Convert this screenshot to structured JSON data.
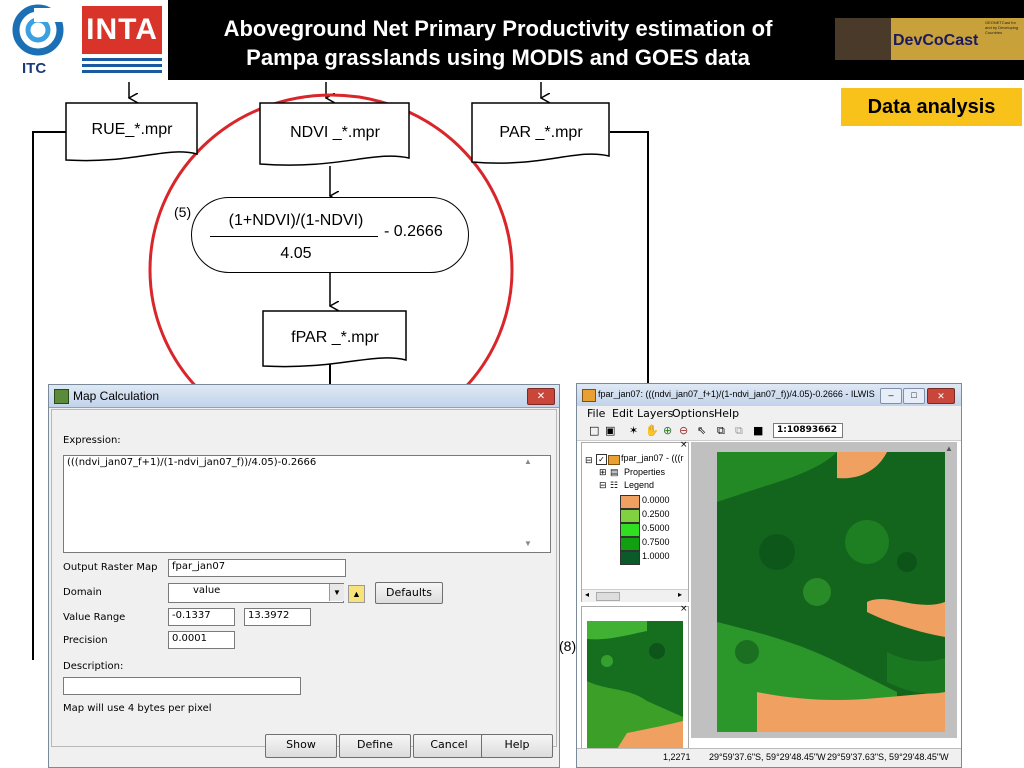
{
  "header": {
    "title": "Aboveground Net Primary Productivity estimation of\nPampa grasslands using MODIS and GOES data",
    "itc_text": "ITC",
    "inta_text": "INTA",
    "devcocast_text": "DevCoCast",
    "devcocast_small": "GEONETCast for and by Developing Countries"
  },
  "section_label": "Data analysis",
  "flowchart": {
    "rue_label": "RUE_*.mpr",
    "ndvi_label": "NDVI _*.mpr",
    "par_label": "PAR _*.mpr",
    "formula_num": "(1+NDVI)/(1-NDVI)",
    "formula_den": "4.05",
    "formula_tail": "- 0.2666",
    "step_number": "(5)",
    "fpar_label": "fPAR _*.mpr",
    "step_number_8": "(8)"
  },
  "map_calc": {
    "title": "Map Calculation",
    "expression_label": "Expression:",
    "expression": "(((ndvi_jan07_f+1)/(1-ndvi_jan07_f))/4.05)-0.2666",
    "output_label": "Output Raster Map",
    "output_value": "fpar_jan07",
    "domain_label": "Domain",
    "domain_value": "value",
    "defaults_button": "Defaults",
    "range_label": "Value Range",
    "range_min": "-0.1337",
    "range_max": "13.3972",
    "precision_label": "Precision",
    "precision_value": "0.0001",
    "description_label": "Description:",
    "description_value": "",
    "info_text": "Map will use 4 bytes per pixel",
    "buttons": {
      "show": "Show",
      "define": "Define",
      "cancel": "Cancel",
      "help": "Help"
    }
  },
  "ilwis": {
    "title": "fpar_jan07: (((ndvi_jan07_f+1)/(1-ndvi_jan07_f))/4.05)-0.2666 - ILWIS",
    "menu": [
      "File",
      "Edit",
      "Layers",
      "Options",
      "Help"
    ],
    "scale": "1:10893662",
    "tree_root": "fpar_jan07 - (((r",
    "tree_properties": "Properties",
    "tree_legend": "Legend",
    "legend": [
      {
        "value": "0.0000",
        "color": "#f0a060"
      },
      {
        "value": "0.2500",
        "color": "#80d040"
      },
      {
        "value": "0.5000",
        "color": "#30e020"
      },
      {
        "value": "0.7500",
        "color": "#10a010"
      },
      {
        "value": "1.0000",
        "color": "#0a5a2a"
      }
    ],
    "status": {
      "value": "1,2271",
      "coord1": "29°59'37.6\"S, 59°29'48.45\"W",
      "coord2": "29°59'37.63\"S, 59°29'48.45\"W"
    }
  }
}
